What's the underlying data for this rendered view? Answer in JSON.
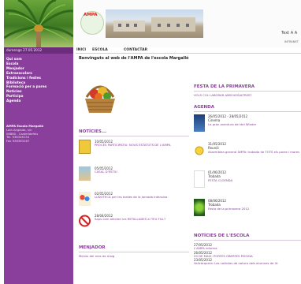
{
  "sidebar": {
    "date": "dumenge 27.05.2012",
    "menu": [
      "Qui som",
      "Escola",
      "Menjador",
      "Extraescolars",
      "Tradicions i festes",
      "Biblioteca",
      "Formació per a pares",
      "Notícies",
      "Participa",
      "Agenda"
    ],
    "info_title": "AMPA Escola Margalló",
    "info_lines": [
      "Lola Anglada, s/n",
      "08860 - Castelldefels",
      "Tel. 936346154",
      "Fax 936363167"
    ]
  },
  "header": {
    "logo_text": "AMPA",
    "textsize": "Text A A",
    "intranet": "INTRANET"
  },
  "nav": [
    "INICI",
    "ESCOLA",
    "CONTACTAR"
  ],
  "welcome": "Benvinguts al web de l'AMPA de l'escola Margalló",
  "noticies": {
    "title": "NOTÍCIES...",
    "items": [
      {
        "date": "10/05/2012",
        "title": "PROCÉS PARTICIPATIU: NOUS ESTATUTS DE L'AMPA"
      },
      {
        "date": "05/05/2012",
        "title": "CASAL D'ESTIU"
      },
      {
        "date": "02/05/2012",
        "title": "LUDOTECA per les tardes de la jornada intensiva"
      },
      {
        "date": "28/04/2012",
        "title": "Saps com afecten les RETALLADES al TEU FILL?"
      }
    ]
  },
  "menjador": {
    "title": "MENJADOR",
    "text": "Menús del mes de maig"
  },
  "festa": {
    "title": "FESTA DE LA PRIMAVERA",
    "text": "VOLS COL·LABORAR AMB NOSALTRES?"
  },
  "agenda": {
    "title": "AGENDA",
    "items": [
      {
        "date": "26/05/2012 - 28/05/2012",
        "cat": "Cinema",
        "text": "La gran aventura del del Winder"
      },
      {
        "date": "31/05/2012",
        "cat": "Reunió",
        "text": "Assemblea general AMPA: trobada de TOTS els pares i mares"
      },
      {
        "date": "01/06/2012",
        "cat": "Trobada",
        "text": "FESTA CLOENDA"
      },
      {
        "date": "08/06/2012",
        "cat": "Trobada",
        "text": "Festa de la primavera 2012"
      }
    ]
  },
  "escola": {
    "title": "NOTÍCIES DE L'ESCOLA",
    "items": [
      {
        "date": "27/05/2012",
        "text": "L'AMPA informa"
      },
      {
        "date": "26/05/2012",
        "text": "29 DE MAIG: PORTES OBERTES PISCINA"
      },
      {
        "date": "23/05/2012",
        "text": "Vallcàrquera: Les colònies de natura dels alumnes de 4t"
      }
    ]
  },
  "colors": {
    "accent": "#8a3f9c",
    "sidebar": "#8a3f9c"
  }
}
